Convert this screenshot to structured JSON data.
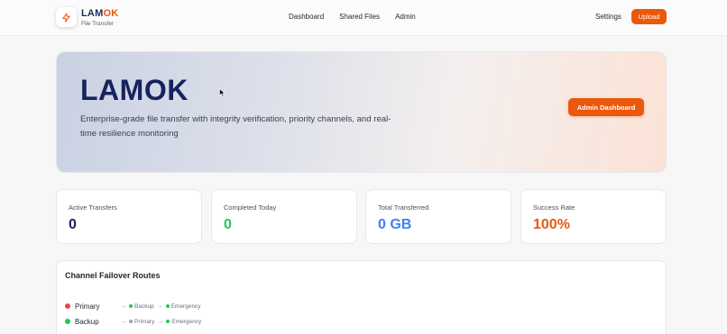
{
  "brand": {
    "title_main": "LAM",
    "title_accent": "OK",
    "subtitle": "File Transfer",
    "icon": "lightning-icon"
  },
  "nav": {
    "links": [
      "Dashboard",
      "Shared Files",
      "Admin"
    ],
    "settings": "Settings",
    "upload": "Upload"
  },
  "hero": {
    "title": "LAMOK",
    "description": "Enterprise-grade file transfer with integrity verification, priority channels, and real-time resilience monitoring",
    "button": "Admin Dashboard"
  },
  "stats": [
    {
      "label": "Active Transfers",
      "value": "0",
      "color": "#16235c"
    },
    {
      "label": "Completed Today",
      "value": "0",
      "color": "#22c55e"
    },
    {
      "label": "Total Transferred",
      "value": "0 GB",
      "color": "#3b82f6"
    },
    {
      "label": "Success Rate",
      "value": "100%",
      "color": "#ea580c"
    }
  ],
  "failover": {
    "title": "Channel Failover Routes",
    "routes": [
      {
        "name": "Primary",
        "color": "#ef4444",
        "steps": [
          {
            "label": "Backup",
            "color": "#22c55e"
          },
          {
            "label": "Emergency",
            "color": "#22c55e"
          }
        ]
      },
      {
        "name": "Backup",
        "color": "#22c55e",
        "steps": [
          {
            "label": "Primary",
            "color": "#9ca3af"
          },
          {
            "label": "Emergency",
            "color": "#22c55e"
          }
        ]
      }
    ]
  },
  "colors": {
    "accent": "#ea580c",
    "navy": "#16235c"
  }
}
